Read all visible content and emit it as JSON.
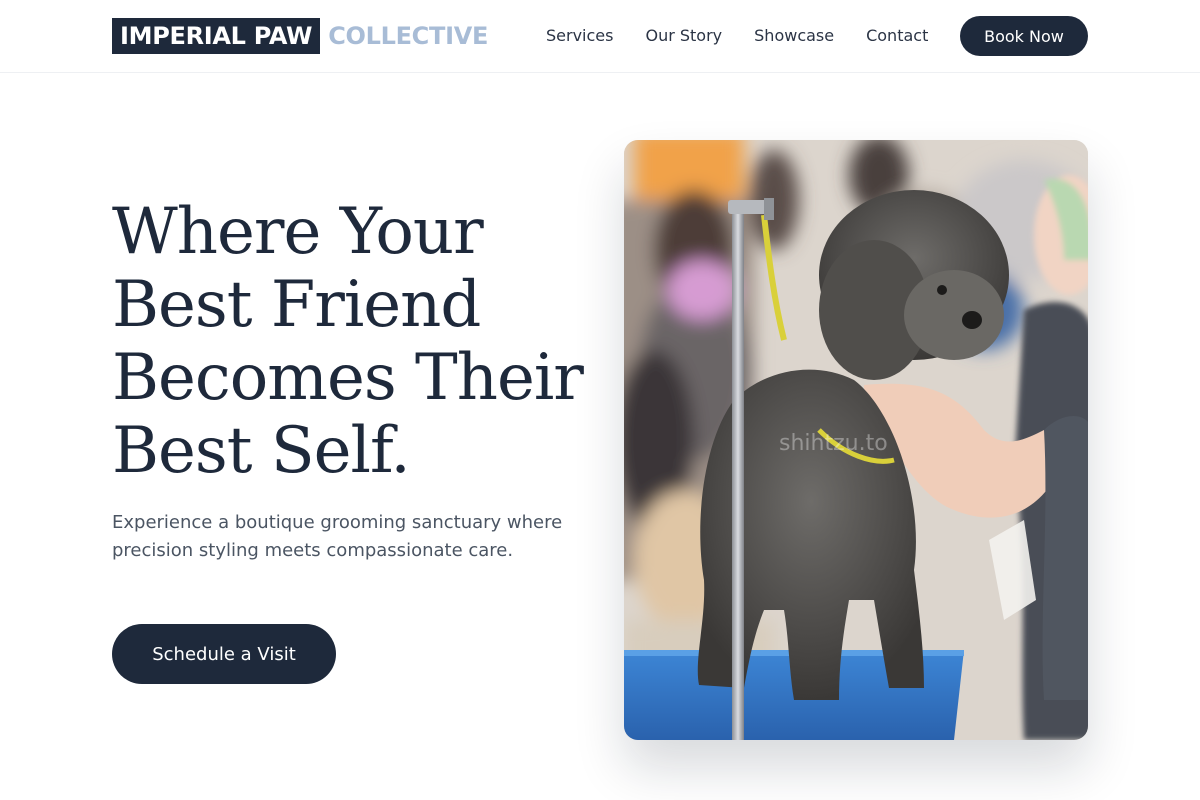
{
  "header": {
    "logo_main": "IMPERIAL PAW",
    "logo_sub": "COLLECTIVE",
    "nav": [
      "Services",
      "Our Story",
      "Showcase",
      "Contact"
    ],
    "cta": "Book Now"
  },
  "hero": {
    "title_lines": [
      "Where Your",
      "Best Friend",
      "Becomes Their",
      "Best Self."
    ],
    "subtitle": "Experience a boutique grooming sanctuary where precision styling meets compassionate care.",
    "cta": "Schedule a Visit",
    "photo_watermark": "shihtzu.to"
  },
  "colors": {
    "primary": "#1e293b",
    "logo_accent": "#a8bcd6",
    "body_text": "#4b5563"
  }
}
